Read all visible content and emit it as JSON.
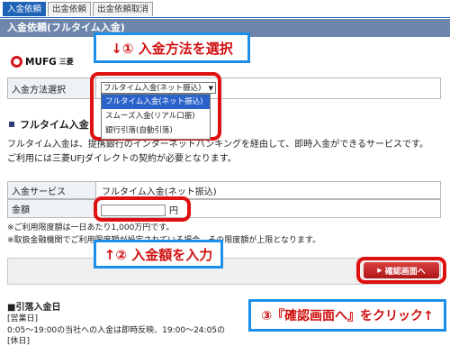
{
  "tabs": [
    {
      "label": "入金依頼",
      "active": true
    },
    {
      "label": "出金依頼",
      "active": false
    },
    {
      "label": "出金依頼取消",
      "active": false
    }
  ],
  "header": {
    "title": "入金依頼(フルタイム入金)"
  },
  "logo": {
    "mark": "mufg-logo",
    "text": "MUFG",
    "sub": "三菱"
  },
  "method_row": {
    "label": "入金方法選択",
    "selected": "フルタイム入金(ネット振込)",
    "options": [
      "フルタイム入金(ネット振込)",
      "スムーズ入金(リアル口振)",
      "銀行引落(自動引落)"
    ]
  },
  "section": {
    "title": "フルタイム入金",
    "desc_line1": "フルタイム入金は、提携銀行のインターネットバンキングを経由して、即時入金ができるサービスです。",
    "desc_line2": "ご利用には三菱UFJダイレクトの契約が必要となります。"
  },
  "service_row": {
    "label": "入金サービス",
    "value": "フルタイム入金(ネット振込)"
  },
  "amount_row": {
    "label": "金額",
    "value": "",
    "unit": "円"
  },
  "notes": {
    "line1": "※ご利用限度額は一日あたり1,000万円です。",
    "line2": "※取扱金融機関でご利用限度額が設定されている場合、その限度額が上限となります。"
  },
  "confirm_button": {
    "label": "確認画面へ",
    "icon": "triangle-right-icon"
  },
  "footer": {
    "title": "■引落入金日",
    "line1": "[営業日]",
    "line2": "0:05～19:00の当社への入金は即時反映、19:00～24:05の",
    "line3": "[休日]"
  },
  "callouts": {
    "step1": "↓① 入金方法を選択",
    "step2": "↑② 入金額を入力",
    "step3": "③『確認画面へ』をクリック↑"
  },
  "colors": {
    "accent": "#1f63b8",
    "header": "#6e86ab",
    "highlight": "#e01010",
    "callout_border": "#1e8fe8",
    "callout_text": "#d01010"
  }
}
